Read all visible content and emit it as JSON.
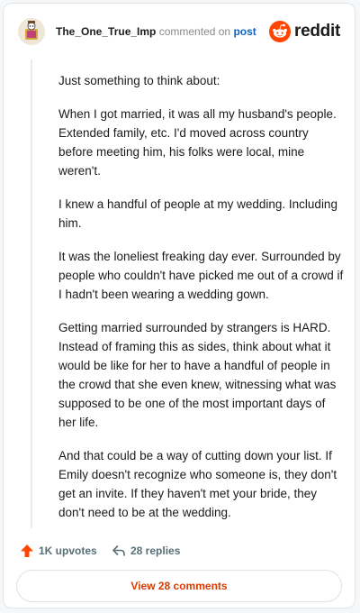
{
  "header": {
    "username": "The_One_True_Imp",
    "commented_text": "commented on",
    "post_link": "post",
    "brand": "reddit",
    "brand_color": "#ff4500",
    "avatar_icon": "snoo-avatar-icon"
  },
  "comment": {
    "paragraphs": [
      "Just something to think about:",
      "When I got married, it was all my husband's people. Extended family, etc. I'd moved across country before meeting him, his folks were local, mine weren't.",
      "I knew a handful of people at my wedding. Including him.",
      "It was the loneliest freaking day ever. Surrounded by people who couldn't have picked me out of a crowd if I hadn't been wearing a wedding gown.",
      "Getting married surrounded by strangers is HARD. Instead of framing this as sides, think about what it would be like for her to have a handful of people in the crowd that she even knew, witnessing what was supposed to be one of the most important days of her life.",
      "And that could be a way of cutting down your list. If Emily doesn't recognize who someone is, they don't get an invite. If they haven't met your bride, they don't need to be at the wedding."
    ]
  },
  "actions": {
    "upvotes": "1K upvotes",
    "replies": "28 replies",
    "view_comments": "View 28 comments",
    "upvote_color": "#ff4500"
  }
}
